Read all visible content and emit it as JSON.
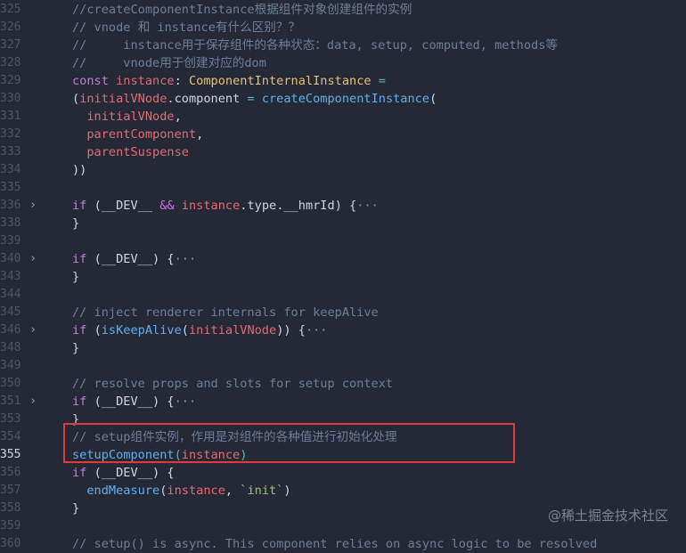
{
  "lines": [
    {
      "n": "325",
      "fold": "",
      "tokens": [
        {
          "t": "//createComponentInstance根据组件对象创建组件的实例",
          "c": "cm"
        }
      ]
    },
    {
      "n": "326",
      "fold": "",
      "tokens": [
        {
          "t": "// vnode 和 instance有什么区别？？",
          "c": "cm"
        }
      ]
    },
    {
      "n": "327",
      "fold": "",
      "tokens": [
        {
          "t": "//     instance用于保存组件的各种状态：data, setup, computed, methods等",
          "c": "cm"
        }
      ]
    },
    {
      "n": "328",
      "fold": "",
      "tokens": [
        {
          "t": "//     vnode用于创建对应的dom",
          "c": "cm"
        }
      ]
    },
    {
      "n": "329",
      "fold": "",
      "tokens": [
        {
          "t": "const ",
          "c": "kw"
        },
        {
          "t": "instance",
          "c": "var"
        },
        {
          "t": ": ",
          "c": "pl"
        },
        {
          "t": "ComponentInternalInstance",
          "c": "ty"
        },
        {
          "t": " =",
          "c": "op"
        }
      ]
    },
    {
      "n": "330",
      "fold": "",
      "tokens": [
        {
          "t": "(",
          "c": "pl"
        },
        {
          "t": "initialVNode",
          "c": "var"
        },
        {
          "t": ".component ",
          "c": "pl"
        },
        {
          "t": "= ",
          "c": "op"
        },
        {
          "t": "createComponentInstance",
          "c": "fn"
        },
        {
          "t": "(",
          "c": "pl"
        }
      ]
    },
    {
      "n": "331",
      "fold": "",
      "tokens": [
        {
          "t": "  initialVNode",
          "c": "var"
        },
        {
          "t": ",",
          "c": "pl"
        }
      ]
    },
    {
      "n": "332",
      "fold": "",
      "tokens": [
        {
          "t": "  parentComponent",
          "c": "var"
        },
        {
          "t": ",",
          "c": "pl"
        }
      ]
    },
    {
      "n": "333",
      "fold": "",
      "tokens": [
        {
          "t": "  parentSuspense",
          "c": "var"
        }
      ]
    },
    {
      "n": "334",
      "fold": "",
      "tokens": [
        {
          "t": "))",
          "c": "pl"
        }
      ]
    },
    {
      "n": "335",
      "fold": "",
      "tokens": []
    },
    {
      "n": "336",
      "fold": "›",
      "tokens": [
        {
          "t": "if ",
          "c": "kw"
        },
        {
          "t": "(__DEV__ ",
          "c": "pl"
        },
        {
          "t": "&& ",
          "c": "kw"
        },
        {
          "t": "instance",
          "c": "var"
        },
        {
          "t": ".type.",
          "c": "pl"
        },
        {
          "t": "__hmrId",
          "c": "pl"
        },
        {
          "t": ") {",
          "c": "pl"
        },
        {
          "t": "···",
          "c": "el"
        }
      ]
    },
    {
      "n": "338",
      "fold": "",
      "tokens": [
        {
          "t": "}",
          "c": "pl"
        }
      ]
    },
    {
      "n": "339",
      "fold": "",
      "tokens": []
    },
    {
      "n": "340",
      "fold": "›",
      "tokens": [
        {
          "t": "if ",
          "c": "kw"
        },
        {
          "t": "(__DEV__) {",
          "c": "pl"
        },
        {
          "t": "···",
          "c": "el"
        }
      ]
    },
    {
      "n": "343",
      "fold": "",
      "tokens": [
        {
          "t": "}",
          "c": "pl"
        }
      ]
    },
    {
      "n": "344",
      "fold": "",
      "tokens": []
    },
    {
      "n": "345",
      "fold": "",
      "tokens": [
        {
          "t": "// inject renderer internals for keepAlive",
          "c": "cm"
        }
      ]
    },
    {
      "n": "346",
      "fold": "›",
      "tokens": [
        {
          "t": "if ",
          "c": "kw"
        },
        {
          "t": "(",
          "c": "pl"
        },
        {
          "t": "isKeepAlive",
          "c": "fn"
        },
        {
          "t": "(",
          "c": "pl"
        },
        {
          "t": "initialVNode",
          "c": "var"
        },
        {
          "t": ")) {",
          "c": "pl"
        },
        {
          "t": "···",
          "c": "el"
        }
      ]
    },
    {
      "n": "348",
      "fold": "",
      "tokens": [
        {
          "t": "}",
          "c": "pl"
        }
      ]
    },
    {
      "n": "349",
      "fold": "",
      "tokens": []
    },
    {
      "n": "350",
      "fold": "",
      "tokens": [
        {
          "t": "// resolve props and slots for setup context",
          "c": "cm"
        }
      ]
    },
    {
      "n": "351",
      "fold": "›",
      "tokens": [
        {
          "t": "if ",
          "c": "kw"
        },
        {
          "t": "(__DEV__) {",
          "c": "pl"
        },
        {
          "t": "···",
          "c": "el"
        }
      ]
    },
    {
      "n": "353",
      "fold": "",
      "tokens": [
        {
          "t": "}",
          "c": "pl"
        }
      ]
    },
    {
      "n": "354",
      "fold": "",
      "tokens": [
        {
          "t": "// setup组件实例，作用是对组件的各种值进行初始化处理",
          "c": "cm"
        }
      ]
    },
    {
      "n": "355",
      "fold": "",
      "current": true,
      "tokens": [
        {
          "t": "setupComponent",
          "c": "fn"
        },
        {
          "t": "(",
          "c": "op"
        },
        {
          "t": "instance",
          "c": "var"
        },
        {
          "t": ")",
          "c": "op"
        }
      ]
    },
    {
      "n": "356",
      "fold": "",
      "tokens": [
        {
          "t": "if ",
          "c": "kw"
        },
        {
          "t": "(__DEV__) {",
          "c": "pl"
        }
      ]
    },
    {
      "n": "357",
      "fold": "",
      "tokens": [
        {
          "t": "  endMeasure",
          "c": "fn"
        },
        {
          "t": "(",
          "c": "pl"
        },
        {
          "t": "instance",
          "c": "var"
        },
        {
          "t": ", ",
          "c": "pl"
        },
        {
          "t": "`init`",
          "c": "str"
        },
        {
          "t": ")",
          "c": "pl"
        }
      ]
    },
    {
      "n": "358",
      "fold": "",
      "tokens": [
        {
          "t": "}",
          "c": "pl"
        }
      ]
    },
    {
      "n": "359",
      "fold": "",
      "tokens": []
    },
    {
      "n": "360",
      "fold": "",
      "tokens": [
        {
          "t": "// setup() is async. This component relies on async logic to be resolved",
          "c": "cm"
        }
      ]
    }
  ],
  "watermark": "@稀土掘金技术社区",
  "colors": {
    "background": "#242935",
    "highlight_box": "#e03a3a"
  }
}
